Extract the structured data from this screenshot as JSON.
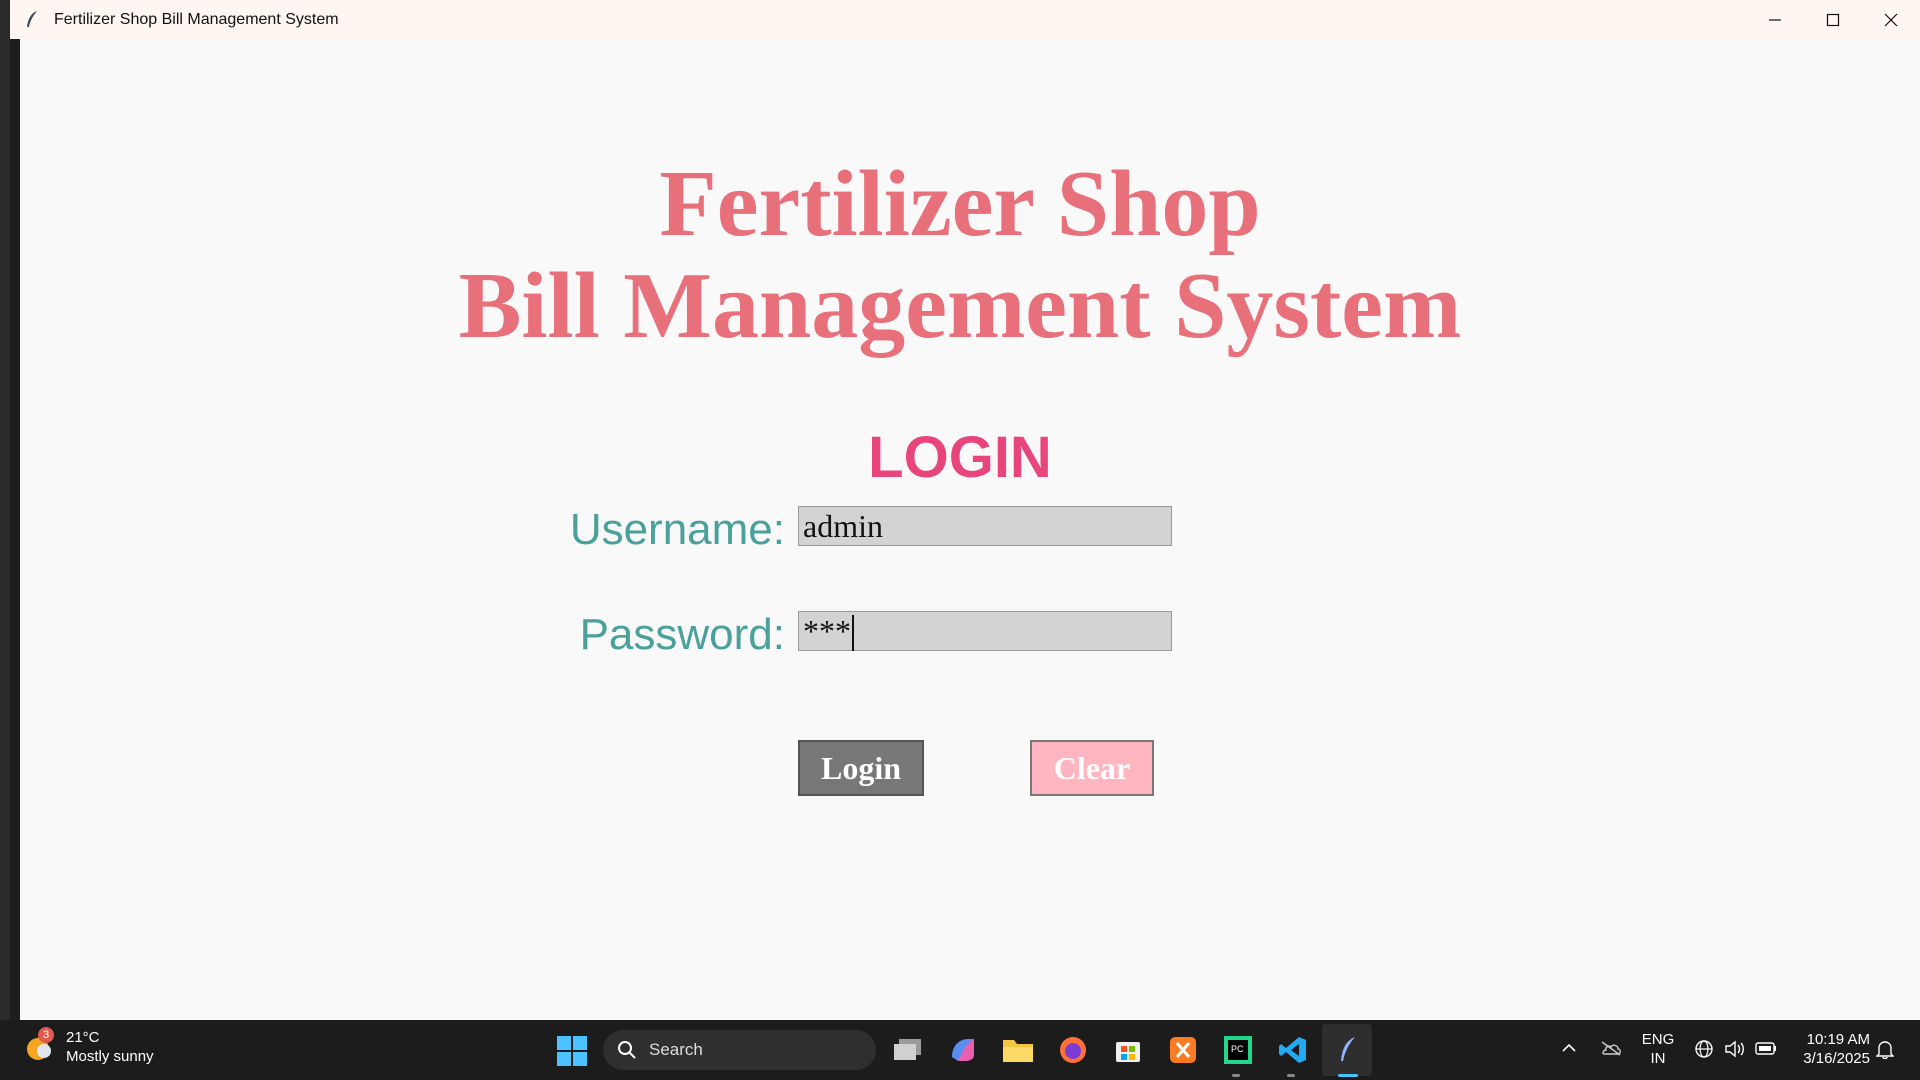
{
  "window": {
    "title": "Fertilizer Shop Bill Management System"
  },
  "main": {
    "heading_line1": "Fertilizer Shop",
    "heading_line2": "Bill Management System",
    "login_title": "LOGIN",
    "username_label": "Username:",
    "username_value": "admin",
    "password_label": "Password:",
    "password_value": "***",
    "login_button": "Login",
    "clear_button": "Clear"
  },
  "colors": {
    "heading": "#e8707b",
    "login_title": "#e8457b",
    "labels": "#4aa09b",
    "field_bg": "#d3d3d3",
    "login_button": "#777777",
    "clear_button": "#ffb6c1"
  },
  "taskbar": {
    "weather_badge": "3",
    "weather_temp": "21°C",
    "weather_desc": "Mostly sunny",
    "search_label": "Search",
    "lang_line1": "ENG",
    "lang_line2": "IN",
    "time": "10:19 AM",
    "date": "3/16/2025",
    "icons": [
      "windows-start-icon",
      "search-icon",
      "task-view-icon",
      "copilot-icon",
      "file-explorer-icon",
      "firefox-icon",
      "store-icon",
      "xampp-icon",
      "pycharm-icon",
      "vscode-icon",
      "python-feather-icon"
    ]
  }
}
